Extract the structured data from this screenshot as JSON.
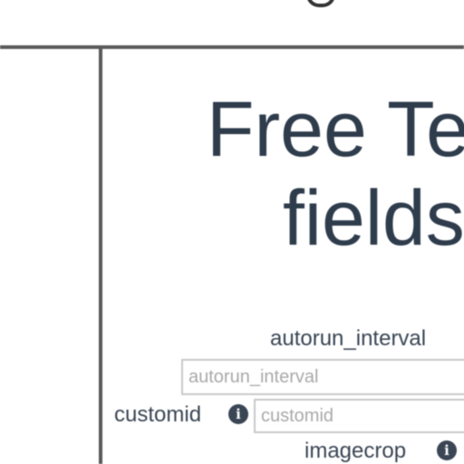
{
  "form": {
    "title_line1": "Free Te",
    "title_line2": "fields",
    "autorun_interval": {
      "label": "autorun_interval",
      "placeholder": "autorun_interval"
    },
    "customid": {
      "label": "customid",
      "placeholder": "customid",
      "info_icon": "info-icon"
    },
    "imagecrop": {
      "label": "imagecrop",
      "info_icon": "info-icon"
    }
  },
  "colors": {
    "text": "#2e3c4c",
    "rule": "#5a5a5a",
    "field_border": "#c9c9c9"
  }
}
